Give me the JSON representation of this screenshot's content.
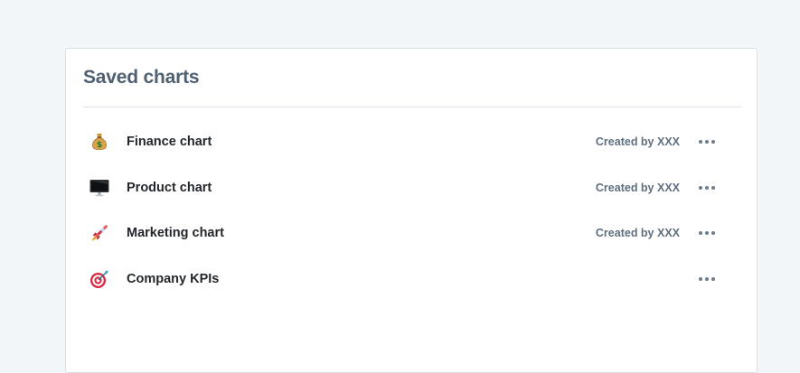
{
  "panel": {
    "title": "Saved charts"
  },
  "charts": [
    {
      "name": "Finance chart",
      "creator": "Created by XXX",
      "icon": "money-bag-icon"
    },
    {
      "name": "Product chart",
      "creator": "Created by XXX",
      "icon": "desktop-computer-icon"
    },
    {
      "name": "Marketing chart",
      "creator": "Created by XXX",
      "icon": "rocket-icon"
    },
    {
      "name": "Company KPIs",
      "creator": "",
      "icon": "target-icon"
    }
  ],
  "colors": {
    "page_background": "#f3f6f9",
    "panel_background": "#ffffff",
    "title": "#4f6070",
    "item_text": "#23272b",
    "meta_text": "#5f6f7e"
  }
}
